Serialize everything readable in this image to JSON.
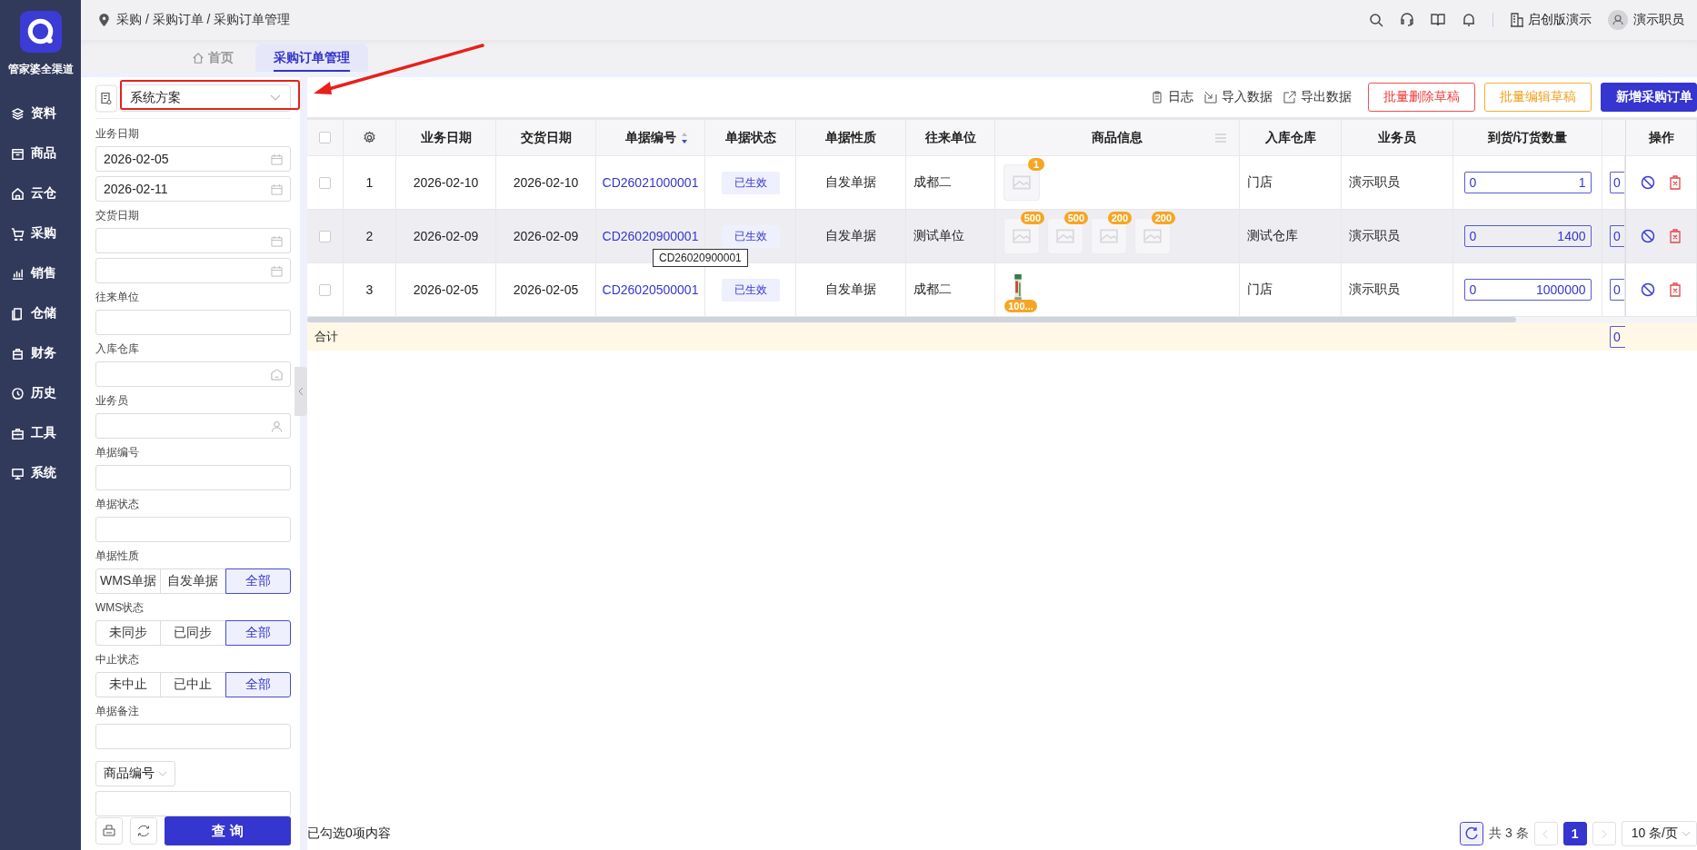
{
  "app_name": "管家婆全渠道",
  "nav": [
    {
      "label": "资料"
    },
    {
      "label": "商品"
    },
    {
      "label": "云仓"
    },
    {
      "label": "采购"
    },
    {
      "label": "销售"
    },
    {
      "label": "仓储"
    },
    {
      "label": "财务"
    },
    {
      "label": "历史"
    },
    {
      "label": "工具"
    },
    {
      "label": "系统"
    }
  ],
  "breadcrumb": "采购 / 采购订单 / 采购订单管理",
  "header": {
    "edition": "启创版演示",
    "user": "演示职员"
  },
  "tabs": [
    {
      "label": "首页",
      "kind": "home",
      "selected": false
    },
    {
      "label": "采购订单管理",
      "kind": "page",
      "selected": true
    }
  ],
  "scheme": {
    "value": "系统方案"
  },
  "filters": [
    {
      "kind": "date",
      "label": "业务日期",
      "from": "2026-02-05",
      "to": "2026-02-11"
    },
    {
      "kind": "date",
      "label": "交货日期"
    },
    {
      "kind": "text",
      "label": "往来单位"
    },
    {
      "kind": "warehouse",
      "label": "入库仓库"
    },
    {
      "kind": "person",
      "label": "业务员"
    },
    {
      "kind": "text",
      "label": "单据编号"
    },
    {
      "kind": "text",
      "label": "单据状态"
    },
    {
      "kind": "segmented",
      "label": "单据性质",
      "options": [
        {
          "label": "WMS单据",
          "selected": false
        },
        {
          "label": "自发单据",
          "selected": false
        },
        {
          "label": "全部",
          "selected": true
        }
      ]
    },
    {
      "kind": "segmented",
      "label": "WMS状态",
      "options": [
        {
          "label": "未同步",
          "selected": false
        },
        {
          "label": "已同步",
          "selected": false
        },
        {
          "label": "全部",
          "selected": true
        }
      ]
    },
    {
      "kind": "segmented",
      "label": "中止状态",
      "options": [
        {
          "label": "未中止",
          "selected": false
        },
        {
          "label": "已中止",
          "selected": false
        },
        {
          "label": "全部",
          "selected": true
        }
      ]
    },
    {
      "kind": "text",
      "label": "单据备注"
    },
    {
      "kind": "select",
      "label": "商品编号"
    }
  ],
  "query_button": "查 询",
  "toolbar": {
    "links": [
      {
        "label": "日志"
      },
      {
        "label": "导入数据"
      },
      {
        "label": "导出数据"
      }
    ],
    "buttons": [
      {
        "label": "批量删除草稿",
        "kind": "danger"
      },
      {
        "label": "批量编辑草稿",
        "kind": "warning"
      },
      {
        "label": "新增采购订单",
        "kind": "primary"
      }
    ]
  },
  "columns": [
    {
      "kind": "checkbox",
      "checked": false
    },
    {
      "kind": "settings"
    },
    {
      "kind": "text",
      "label": "业务日期"
    },
    {
      "kind": "text",
      "label": "交货日期"
    },
    {
      "kind": "text",
      "label": "单据编号",
      "sorted_descending": true
    },
    {
      "kind": "text",
      "label": "单据状态"
    },
    {
      "kind": "text",
      "label": "单据性质"
    },
    {
      "kind": "text",
      "label": "往来单位"
    },
    {
      "kind": "text",
      "label": "商品信息",
      "menu": true
    },
    {
      "kind": "text",
      "label": "入库仓库"
    },
    {
      "kind": "text",
      "label": "业务员"
    },
    {
      "kind": "text",
      "label": "到货/订货数量"
    },
    {
      "kind": "cut"
    },
    {
      "kind": "text",
      "label": "操作"
    }
  ],
  "rows": [
    {
      "checked": false,
      "highlighted": false,
      "index": "1",
      "biz_date": "2026-02-10",
      "delivery_date": "2026-02-10",
      "number": "CD26021000001",
      "status": "已生效",
      "nature": "自发单据",
      "partner": "成都二",
      "products": [
        {
          "kind": "placeholder",
          "badge": "1"
        }
      ],
      "warehouse": "门店",
      "clerk": "演示职员",
      "received": "0",
      "ordered": "1",
      "column_13": "0"
    },
    {
      "checked": false,
      "highlighted": true,
      "index": "2",
      "biz_date": "2026-02-09",
      "delivery_date": "2026-02-09",
      "number": "CD26020900001",
      "status": "已生效",
      "nature": "自发单据",
      "partner": "测试单位",
      "products": [
        {
          "kind": "placeholder",
          "badge": "500"
        },
        {
          "kind": "placeholder",
          "badge": "500"
        },
        {
          "kind": "placeholder",
          "badge": "200"
        },
        {
          "kind": "placeholder",
          "badge": "200"
        }
      ],
      "warehouse": "测试仓库",
      "clerk": "演示职员",
      "received": "0",
      "ordered": "1400",
      "column_13": "0"
    },
    {
      "checked": false,
      "highlighted": false,
      "index": "3",
      "biz_date": "2026-02-05",
      "delivery_date": "2026-02-05",
      "number": "CD26020500001",
      "status": "已生效",
      "nature": "自发单据",
      "partner": "成都二",
      "products": [
        {
          "kind": "picture",
          "badge": "100..."
        }
      ],
      "warehouse": "门店",
      "clerk": "演示职员",
      "received": "0",
      "ordered": "1000000",
      "column_13": "0"
    }
  ],
  "totals": {
    "label": "合计",
    "column_13": "0"
  },
  "tooltip": "CD26020900001",
  "footer": {
    "selected_text": "已勾选0项内容"
  },
  "pagination": {
    "total": "共 3 条",
    "pages": [
      {
        "label": "1",
        "selected": true
      }
    ],
    "page_size": "10 条/页"
  }
}
